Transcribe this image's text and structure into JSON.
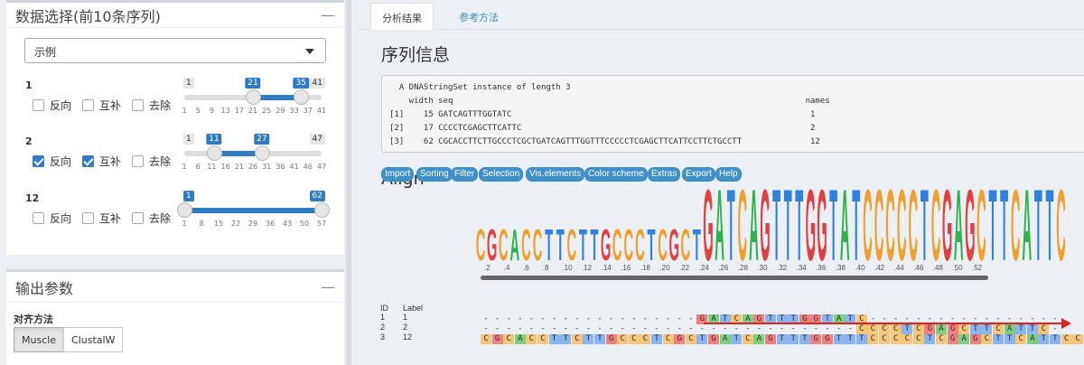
{
  "data_panel": {
    "title": "数据选择(前10条序列)",
    "collapse_icon": "minus-icon",
    "select_value": "示例",
    "rows": [
      {
        "label": "1",
        "reverse": "反向",
        "complement": "互补",
        "remove": "去除",
        "reverse_checked": false,
        "complement_checked": false,
        "remove_checked": false,
        "min": 1,
        "max": 41,
        "from": 21,
        "to": 35,
        "ticks": [
          "1",
          "5",
          "9",
          "13",
          "17",
          "21",
          "25",
          "29",
          "33",
          "37",
          "41"
        ]
      },
      {
        "label": "2",
        "reverse": "反向",
        "complement": "互补",
        "remove": "去除",
        "reverse_checked": true,
        "complement_checked": true,
        "remove_checked": false,
        "min": 1,
        "max": 47,
        "from": 11,
        "to": 27,
        "ticks": [
          "1",
          "6",
          "11",
          "16",
          "21",
          "26",
          "31",
          "36",
          "41",
          "46",
          "47"
        ]
      },
      {
        "label": "12",
        "reverse": "反向",
        "complement": "互补",
        "remove": "去除",
        "reverse_checked": false,
        "complement_checked": false,
        "remove_checked": false,
        "min": 1,
        "max": 62,
        "from": 1,
        "to": 62,
        "ticks": [
          "1",
          "8",
          "15",
          "22",
          "29",
          "36",
          "43",
          "50",
          "57"
        ]
      }
    ]
  },
  "output_panel": {
    "title": "输出参数",
    "collapse_icon": "minus-icon",
    "align_method_label": "对齐方法",
    "methods": [
      "Muscle",
      "ClustalW"
    ],
    "selected_method": "Muscle"
  },
  "tabs": [
    "分析结果",
    "参考方法"
  ],
  "active_tab": "分析结果",
  "seq_info": {
    "heading": "序列信息",
    "lines": [
      "  A DNAStringSet instance of length 3",
      "    width seq                                                                        names",
      "[1]    15 GATCAGTTTGGTATC                                                             1",
      "[2]    17 CCCCTCGAGCTTCATTC                                                           2",
      "[3]    62 CGCACCTTCTTGCCCTCGCTGATCAGTTTGGTTTCCCCCTCGAGCTTCATTCCTTCTGCCTT              12"
    ]
  },
  "align": {
    "heading": "Align",
    "menu": [
      "Import",
      "Sorting",
      "Filter",
      "Selection",
      "Vis.elements",
      "Color scheme",
      "Extras",
      "Export",
      "Help"
    ],
    "ruler": [
      ".2",
      ".4",
      ".6",
      ".8",
      ".10",
      ".12",
      ".14",
      ".16",
      ".18",
      ".20",
      ".22",
      ".24",
      ".26",
      ".28",
      ".30",
      ".32",
      ".34",
      ".36",
      ".38",
      ".40",
      ".42",
      ".44",
      ".46",
      ".48",
      ".50",
      ".52"
    ],
    "id_header": "ID",
    "label_header": "Label",
    "logo_colors": {
      "A": "#2db34a",
      "C": "#f0a030",
      "G": "#e04040",
      "T": "#3080e0"
    },
    "cell_colors": {
      "A": "#7ecf7e",
      "C": "#f5c67a",
      "G": "#f08080",
      "T": "#8ab4f0"
    },
    "rows": [
      {
        "id": "1",
        "label": "1",
        "seq": "-------------------GATCAGTTTGGTATC-----------------"
      },
      {
        "id": "2",
        "label": "2",
        "seq": "---------------------------------CCCCTCGAGCTTCATTC-"
      },
      {
        "id": "3",
        "label": "12",
        "seq": "CGCACCTTCTTGCCCTCGCTGATCAGTTTGGTTTCCCCCTCGAGCTTCATTCC"
      }
    ],
    "logo": "CGCACCTTCTTGCCCTCGCTGATCAGTTTGGTATCCCCCTCGAGCTTCATTC"
  }
}
